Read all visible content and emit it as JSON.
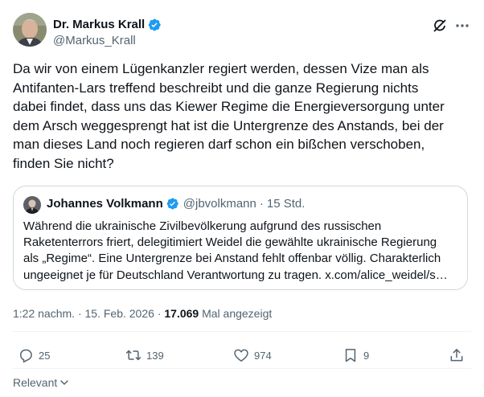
{
  "author": {
    "display_name": "Dr. Markus Krall",
    "handle": "@Markus_Krall",
    "verified": true
  },
  "tweet": {
    "text": "Da wir von einem Lügenkanzler regiert werden, dessen Vize man als\nAntifanten-Lars treffend beschreibt und die ganze Regierung nichts\ndabei findet, dass uns das Kiewer Regime die Energieversorgung unter\ndem Arsch weggesprengt hat ist die Untergrenze des Anstands, bei der\nman dieses Land noch regieren darf schon ein bißchen verschoben,\nfinden Sie nicht?"
  },
  "quoted_tweet": {
    "display_name": "Johannes Volkmann",
    "handle": "@jbvolkmann",
    "separator": "·",
    "time": "15 Std.",
    "text": "Während die ukrainische Zivilbevölkerung aufgrund des russischen\nRaketenterrors friert, delegitimiert Weidel die gewählte ukrainische Regierung\nals „Regime“. Eine Untergrenze bei Anstand fehlt offenbar völlig. Charakterlich\nungeeignet je für Deutschland Verantwortung zu tragen. x.com/alice_weidel/s…"
  },
  "meta": {
    "time": "1:22 nachm.",
    "sep1": "·",
    "date": "15. Feb. 2026",
    "sep2": "·",
    "views": "17.069",
    "views_label": "Mal angezeigt"
  },
  "actions": {
    "replies": "25",
    "retweets": "139",
    "likes": "974",
    "bookmarks": "9"
  },
  "footer": {
    "sort_label": "Relevant"
  },
  "colors": {
    "text": "#0f1419",
    "secondary": "#536471",
    "verified": "#1d9bf0",
    "border": "#cfd9de"
  }
}
